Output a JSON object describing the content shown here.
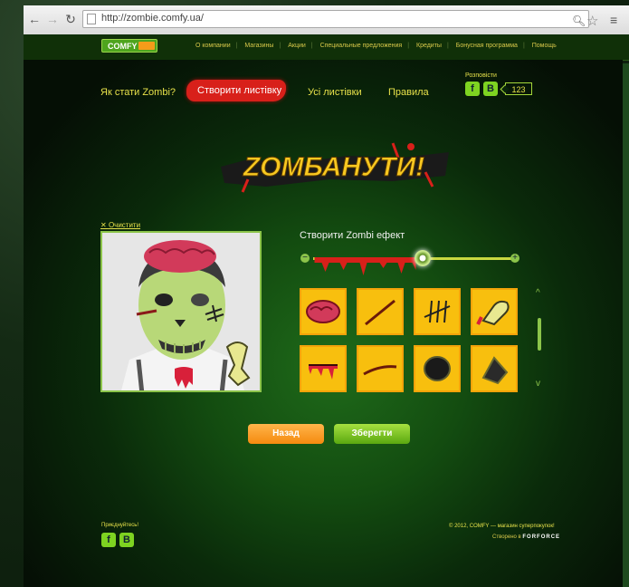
{
  "browser": {
    "url": "http://zombie.comfy.ua/"
  },
  "site_nav": {
    "logo": "COMFY",
    "links": [
      "О компании",
      "Магазины",
      "Акции",
      "Специальные предложения",
      "Кредиты",
      "Бонусная программа",
      "Помощь"
    ]
  },
  "zombie_tabs": {
    "how": "Як стати Zombi?",
    "create": "Створити листівку",
    "all": "Усі листівки",
    "rules": "Правила"
  },
  "share": {
    "label": "Розповісти",
    "fb": "f",
    "vk": "B",
    "count": "123"
  },
  "title": "ZOMБАНУТИ!",
  "editor": {
    "clear": "Очистити",
    "effect_label": "Створити Zombi ефект",
    "effect_level": 0.55,
    "minus": "−",
    "plus": "+",
    "stickers": [
      "brain",
      "wound-line",
      "stitches",
      "bone-hand",
      "bloody-slash",
      "cut",
      "hole",
      "dark-wound"
    ],
    "scroll_up": "^",
    "scroll_down": "v"
  },
  "buttons": {
    "back": "Назад",
    "save": "Зберегти"
  },
  "footer": {
    "join": "Приєднуйтесь!",
    "fb": "f",
    "vk": "B",
    "copyright": "© 2012, COMFY — магазин суперпокупок!",
    "made_by_prefix": "Створено в",
    "made_by": "FORFORCE"
  },
  "colors": {
    "accent_yellow": "#e8e24a",
    "accent_green": "#8cc44a",
    "tile_orange": "#f8bf0e",
    "blood_red": "#d8201a"
  }
}
